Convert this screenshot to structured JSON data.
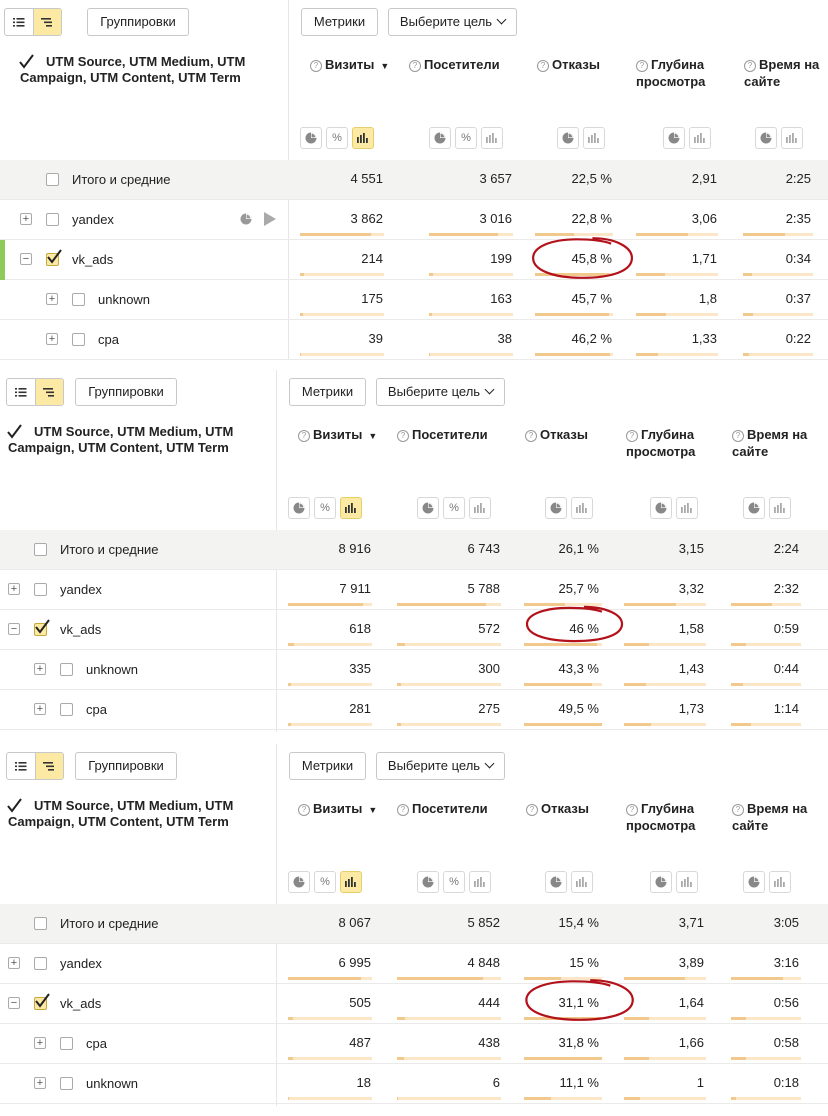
{
  "toolbar": {
    "groupings_label": "Группировки",
    "metrics_label": "Метрики",
    "goal_label": "Выберите цель"
  },
  "dimension_title": "UTM Source, UTM Medium, UTM Campaign, UTM Content, UTM Term",
  "metrics": {
    "visits": "Визиты",
    "visitors": "Посетители",
    "bounces": "Отказы",
    "depth": "Глубина просмотра",
    "time": "Время на сайте"
  },
  "panels": [
    {
      "rows": [
        {
          "label": "Итого и средние",
          "visits": "4 551",
          "visitors": "3 657",
          "bounces": "22,5 %",
          "depth": "2,91",
          "time": "2:25",
          "visits_share": 1.0,
          "visitors_share": 1.0,
          "bounces_share": 0.5,
          "depth_share": 0.6,
          "time_share": 0.5
        },
        {
          "label": "yandex",
          "visits": "3 862",
          "visitors": "3 016",
          "bounces": "22,8 %",
          "depth": "3,06",
          "time": "2:35",
          "visits_share": 0.85,
          "visitors_share": 0.82,
          "bounces_share": 0.5,
          "depth_share": 0.63,
          "time_share": 0.6
        },
        {
          "label": "vk_ads",
          "visits": "214",
          "visitors": "199",
          "bounces": "45,8 %",
          "depth": "1,71",
          "time": "0:34",
          "visits_share": 0.05,
          "visitors_share": 0.05,
          "bounces_share": 0.95,
          "depth_share": 0.35,
          "time_share": 0.13
        },
        {
          "label": "unknown",
          "visits": "175",
          "visitors": "163",
          "bounces": "45,7 %",
          "depth": "1,8",
          "time": "0:37",
          "visits_share": 0.04,
          "visitors_share": 0.04,
          "bounces_share": 0.95,
          "depth_share": 0.37,
          "time_share": 0.14
        },
        {
          "label": "cpa",
          "visits": "39",
          "visitors": "38",
          "bounces": "46,2 %",
          "depth": "1,33",
          "time": "0:22",
          "visits_share": 0.01,
          "visitors_share": 0.01,
          "bounces_share": 0.96,
          "depth_share": 0.27,
          "time_share": 0.08
        }
      ]
    },
    {
      "rows": [
        {
          "label": "Итого и средние",
          "visits": "8 916",
          "visitors": "6 743",
          "bounces": "26,1 %",
          "depth": "3,15",
          "time": "2:24",
          "visits_share": 1.0,
          "visitors_share": 1.0,
          "bounces_share": 0.52,
          "depth_share": 0.6,
          "time_share": 0.55
        },
        {
          "label": "yandex",
          "visits": "7 911",
          "visitors": "5 788",
          "bounces": "25,7 %",
          "depth": "3,32",
          "time": "2:32",
          "visits_share": 0.89,
          "visitors_share": 0.86,
          "bounces_share": 0.52,
          "depth_share": 0.63,
          "time_share": 0.58
        },
        {
          "label": "vk_ads",
          "visits": "618",
          "visitors": "572",
          "bounces": "46 %",
          "depth": "1,58",
          "time": "0:59",
          "visits_share": 0.07,
          "visitors_share": 0.08,
          "bounces_share": 0.93,
          "depth_share": 0.3,
          "time_share": 0.22
        },
        {
          "label": "unknown",
          "visits": "335",
          "visitors": "300",
          "bounces": "43,3 %",
          "depth": "1,43",
          "time": "0:44",
          "visits_share": 0.04,
          "visitors_share": 0.04,
          "bounces_share": 0.87,
          "depth_share": 0.27,
          "time_share": 0.17
        },
        {
          "label": "cpa",
          "visits": "281",
          "visitors": "275",
          "bounces": "49,5 %",
          "depth": "1,73",
          "time": "1:14",
          "visits_share": 0.03,
          "visitors_share": 0.04,
          "bounces_share": 1.0,
          "depth_share": 0.33,
          "time_share": 0.28
        }
      ]
    },
    {
      "rows": [
        {
          "label": "Итого и средние",
          "visits": "8 067",
          "visitors": "5 852",
          "bounces": "15,4 %",
          "depth": "3,71",
          "time": "3:05",
          "visits_share": 1.0,
          "visitors_share": 1.0,
          "bounces_share": 0.48,
          "depth_share": 0.7,
          "time_share": 0.7
        },
        {
          "label": "yandex",
          "visits": "6 995",
          "visitors": "4 848",
          "bounces": "15 %",
          "depth": "3,89",
          "time": "3:16",
          "visits_share": 0.87,
          "visitors_share": 0.83,
          "bounces_share": 0.47,
          "depth_share": 0.74,
          "time_share": 0.74
        },
        {
          "label": "vk_ads",
          "visits": "505",
          "visitors": "444",
          "bounces": "31,1 %",
          "depth": "1,64",
          "time": "0:56",
          "visits_share": 0.06,
          "visitors_share": 0.08,
          "bounces_share": 0.97,
          "depth_share": 0.31,
          "time_share": 0.21
        },
        {
          "label": "cpa",
          "visits": "487",
          "visitors": "438",
          "bounces": "31,8 %",
          "depth": "1,66",
          "time": "0:58",
          "visits_share": 0.06,
          "visitors_share": 0.07,
          "bounces_share": 1.0,
          "depth_share": 0.31,
          "time_share": 0.22
        },
        {
          "label": "unknown",
          "visits": "18",
          "visitors": "6",
          "bounces": "11,1 %",
          "depth": "1",
          "time": "0:18",
          "visits_share": 0.01,
          "visitors_share": 0.01,
          "bounces_share": 0.35,
          "depth_share": 0.19,
          "time_share": 0.07
        }
      ]
    }
  ]
}
